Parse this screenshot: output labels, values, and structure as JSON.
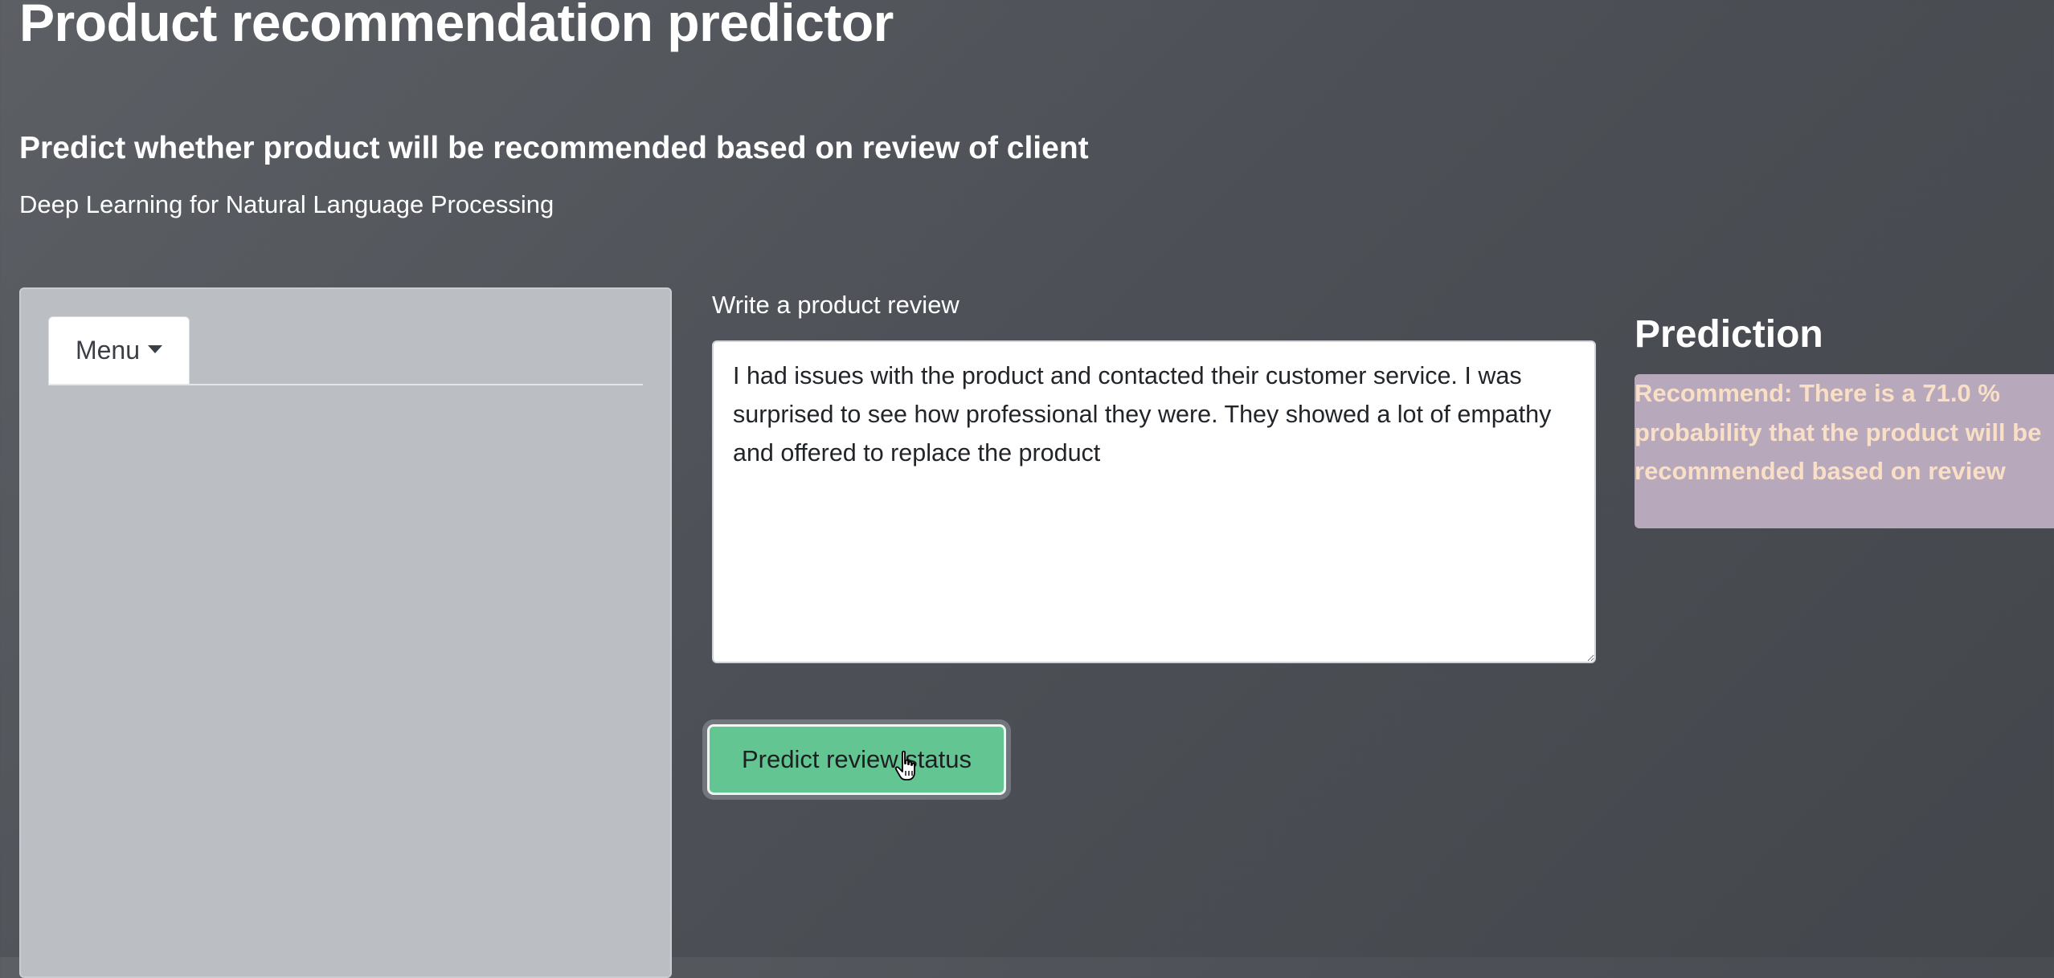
{
  "header": {
    "title": "Product recommendation predictor",
    "subtitle": "Predict whether product will be recommended based on review of client",
    "tagline": "Deep Learning for Natural Language Processing"
  },
  "sidebar": {
    "menu_label": "Menu",
    "menu_icon": "caret-down-icon"
  },
  "form": {
    "review_label": "Write a product review",
    "review_value": "I had issues with the product and contacted their customer service. I was surprised to see how professional they were. They showed a lot of empathy and offered to replace the product",
    "predict_button_label": "Predict review status",
    "predict_button_color": "#62c592"
  },
  "prediction": {
    "heading": "Prediction",
    "result": "Recommend: There is a 71.0 % probability that the product will be recommended based on review",
    "result_background": "#b7a9bb",
    "result_text_color": "#f8dfc6"
  }
}
